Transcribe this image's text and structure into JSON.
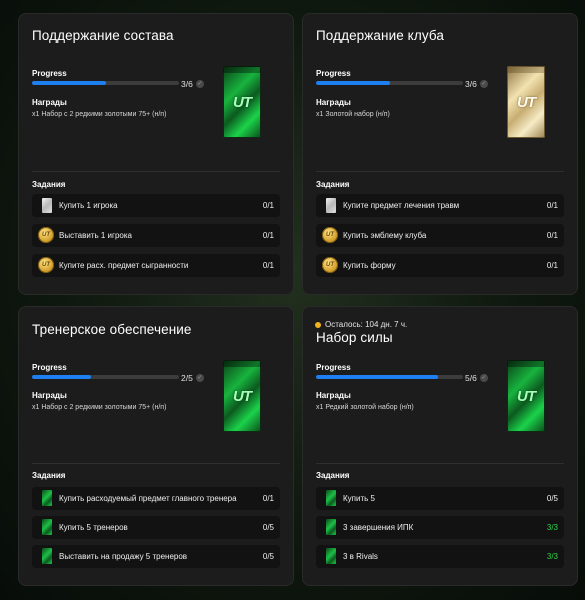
{
  "cards": [
    {
      "title": "Поддержание состава",
      "progress_label": "Progress",
      "progress_value": 0.5,
      "progress_text": "3/6",
      "rewards_label": "Награды",
      "rewards_text": "x1 Набор с 2 редкими золотыми 75+ (н/п)",
      "pack_icon": "green-ut-pack",
      "pack_text": "UT",
      "tasks_label": "Задания",
      "tasks": [
        {
          "icon": "silver-card-icon",
          "text": "Купить 1 игрока",
          "count": "0/1",
          "done": false
        },
        {
          "icon": "ut-coin-icon",
          "icon_text": "UT",
          "text": "Выставить 1 игрока",
          "count": "0/1",
          "done": false
        },
        {
          "icon": "ut-coin-icon",
          "icon_text": "UT",
          "text": "Купите расх. предмет сыгранности",
          "count": "0/1",
          "done": false
        }
      ]
    },
    {
      "title": "Поддержание клуба",
      "progress_label": "Progress",
      "progress_value": 0.5,
      "progress_text": "3/6",
      "rewards_label": "Награды",
      "rewards_text": "x1 Золотой набор (н/п)",
      "pack_icon": "gold-ut-pack",
      "pack_text": "UT",
      "tasks_label": "Задания",
      "tasks": [
        {
          "icon": "silver-card-icon",
          "text": "Купите предмет лечения травм",
          "count": "0/1",
          "done": false
        },
        {
          "icon": "ut-coin-icon",
          "icon_text": "UT",
          "text": "Купить эмблему клуба",
          "count": "0/1",
          "done": false
        },
        {
          "icon": "ut-coin-icon",
          "icon_text": "UT",
          "text": "Купить форму",
          "count": "0/1",
          "done": false
        }
      ]
    },
    {
      "title": "Тренерское обеспечение",
      "progress_label": "Progress",
      "progress_value": 0.4,
      "progress_text": "2/5",
      "rewards_label": "Награды",
      "rewards_text": "x1 Набор с 2 редкими золотыми 75+ (н/п)",
      "pack_icon": "green-ut-pack",
      "pack_text": "UT",
      "tasks_label": "Задания",
      "tasks": [
        {
          "icon": "green-pack-icon",
          "text": "Купить расходуемый предмет главного тренера",
          "count": "0/1",
          "done": false
        },
        {
          "icon": "green-pack-icon",
          "text": "Купить 5 тренеров",
          "count": "0/5",
          "done": false
        },
        {
          "icon": "green-pack-icon",
          "text": "Выставить на продажу 5 тренеров",
          "count": "0/5",
          "done": false
        }
      ]
    },
    {
      "time_left": "Осталось: 104 дн. 7 ч.",
      "time_color": "#f2b01e",
      "title": "Набор силы",
      "progress_label": "Progress",
      "progress_value": 0.833,
      "progress_text": "5/6",
      "rewards_label": "Награды",
      "rewards_text": "x1 Редкий золотой набор (н/п)",
      "pack_icon": "green-ut-pack",
      "pack_text": "UT",
      "tasks_label": "Задания",
      "tasks": [
        {
          "icon": "green-pack-icon",
          "text": "Купить 5",
          "count": "0/5",
          "done": false
        },
        {
          "icon": "green-pack-icon",
          "text": "3 завершения ИПК",
          "count": "3/3",
          "done": true
        },
        {
          "icon": "green-pack-icon",
          "text": "3 в Rivals",
          "count": "3/3",
          "done": true
        }
      ]
    }
  ],
  "colors": {
    "progress_fill": "#1e7ff0",
    "done_count": "#2fd34a",
    "card_bg": "#1c1c1c",
    "task_bg": "#121212"
  }
}
